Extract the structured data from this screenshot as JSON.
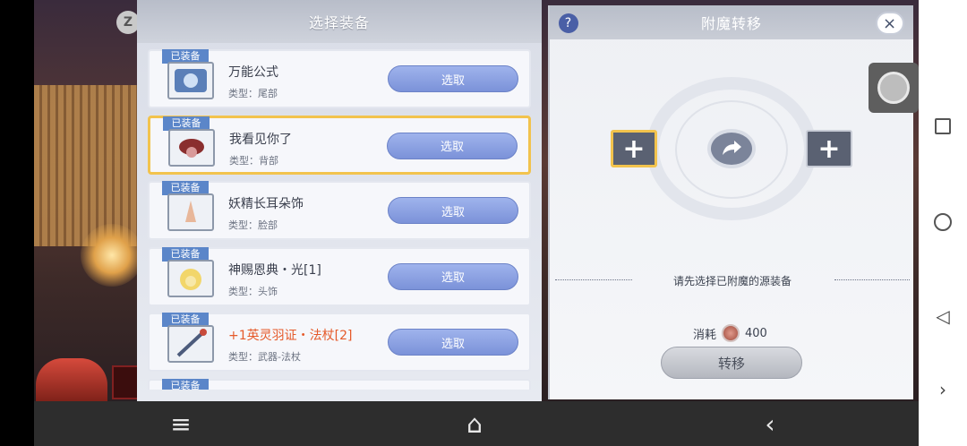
{
  "list_panel": {
    "title": "选择装备",
    "items": [
      {
        "badge": "已装备",
        "name": "万能公式",
        "type": "类型：尾部",
        "button": "选取",
        "selected": false,
        "highlight": false
      },
      {
        "badge": "已装备",
        "name": "我看见你了",
        "type": "类型：背部",
        "button": "选取",
        "selected": true,
        "highlight": false
      },
      {
        "badge": "已装备",
        "name": "妖精长耳朵饰",
        "type": "类型：脸部",
        "button": "选取",
        "selected": false,
        "highlight": false
      },
      {
        "badge": "已装备",
        "name": "神赐恩典・光[1]",
        "type": "类型：头饰",
        "button": "选取",
        "selected": false,
        "highlight": false
      },
      {
        "badge": "已装备",
        "name": "+1英灵羽证・法杖[2]",
        "type": "类型：武器-法杖",
        "button": "选取",
        "selected": false,
        "highlight": true
      },
      {
        "badge": "已装备"
      }
    ]
  },
  "right_panel": {
    "title": "附魔转移",
    "help_icon": "?",
    "close_icon": "×",
    "hint": "请先选择已附魔的源装备",
    "cost_label": "消耗",
    "cost_value": "400",
    "transfer_button": "转移"
  },
  "scene": {
    "z_button": "Z"
  },
  "bottom_bar": {
    "menu_icon": "≡",
    "home_icon": "⌂",
    "back_icon": "‹"
  },
  "android_nav": {
    "back_icon": "◁",
    "more_icon": "›"
  }
}
